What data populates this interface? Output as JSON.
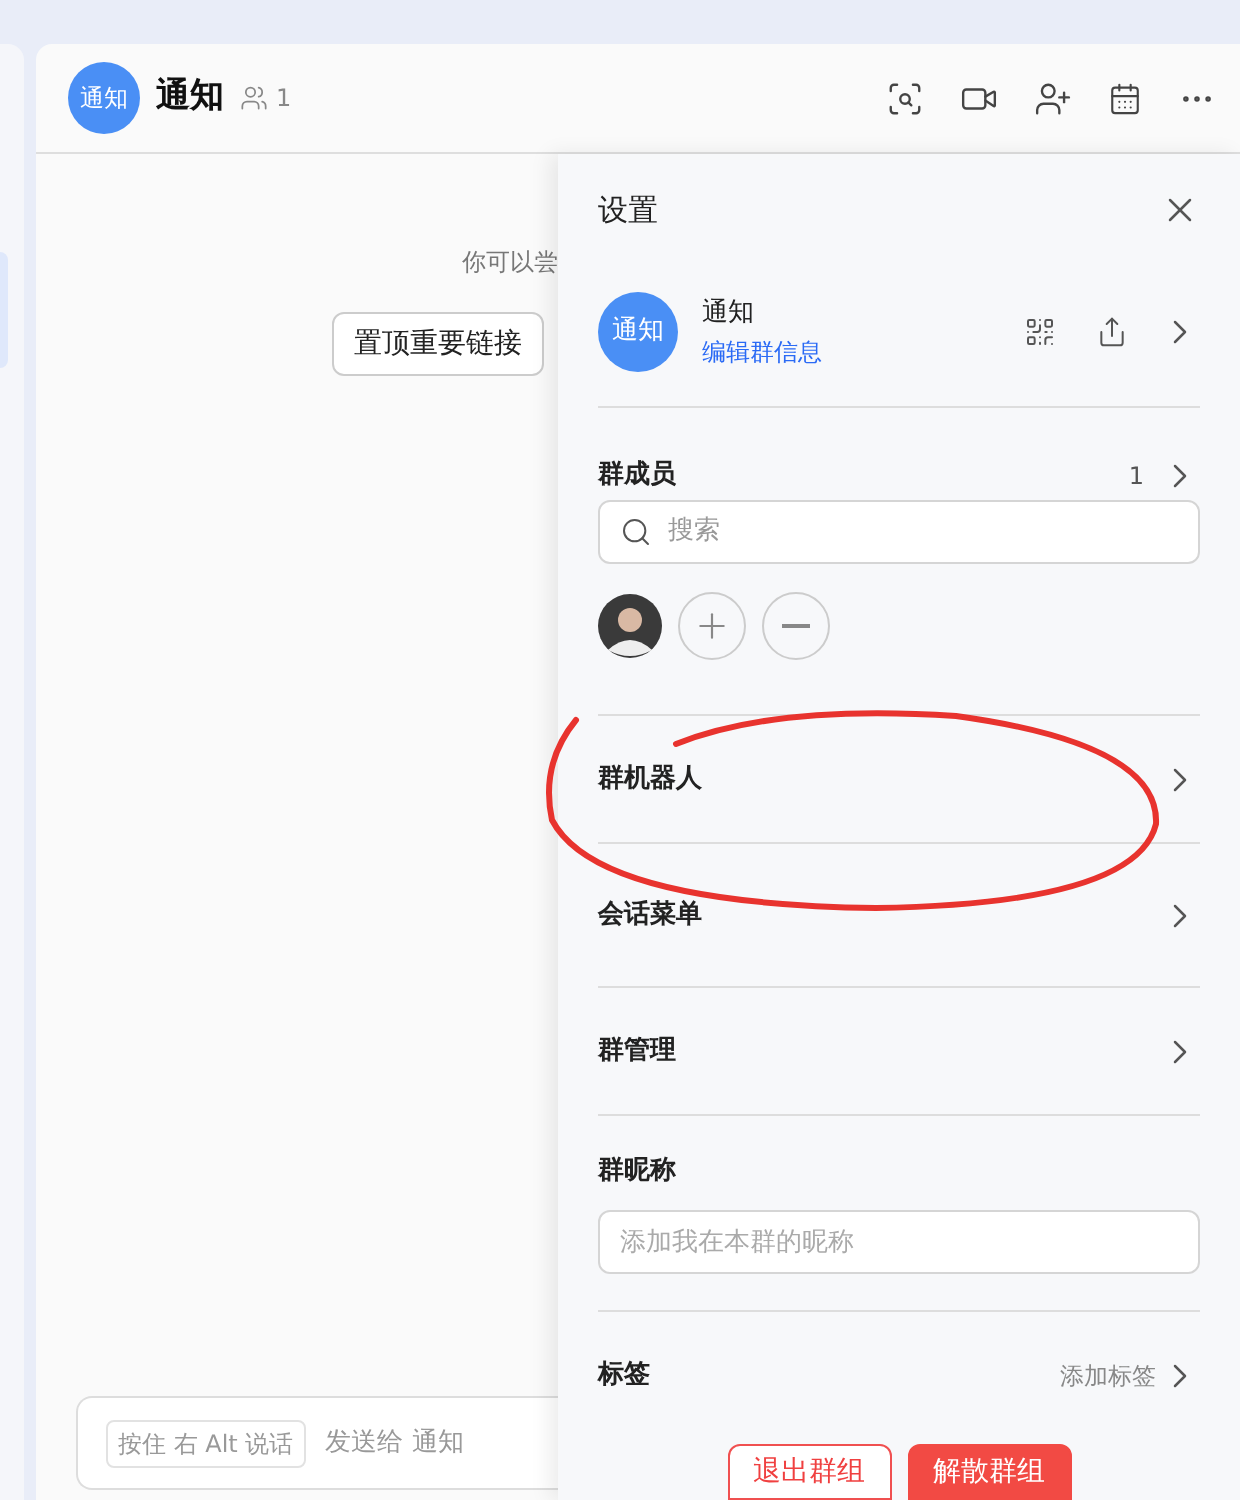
{
  "chat": {
    "avatar_text": "通知",
    "title": "通知",
    "member_count": "1"
  },
  "conversation": {
    "hint": "你可以尝",
    "pin_button": "置顶重要链接"
  },
  "composer": {
    "voice_hint": "按住 右 Alt 说话",
    "placeholder": "发送给 通知"
  },
  "settings": {
    "title": "设置",
    "group": {
      "avatar_text": "通知",
      "name": "通知",
      "edit_link": "编辑群信息"
    },
    "members": {
      "label": "群成员",
      "count": "1",
      "search_placeholder": "搜索"
    },
    "rows": [
      {
        "label": "群机器人"
      },
      {
        "label": "会话菜单"
      },
      {
        "label": "群管理"
      }
    ],
    "nickname": {
      "label": "群昵称",
      "placeholder": "添加我在本群的昵称"
    },
    "tag": {
      "label": "标签",
      "value": "添加标签"
    },
    "buttons": [
      {
        "label": "退出群组",
        "kind": "outline"
      },
      {
        "label": "解散群组",
        "kind": "solid"
      }
    ]
  }
}
